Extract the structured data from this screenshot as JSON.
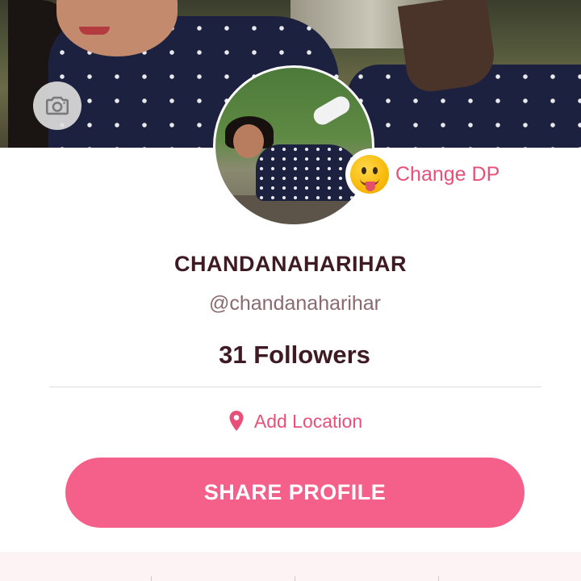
{
  "profile": {
    "display_name": "CHANDANAHARIHAR",
    "handle": "@chandanaharihar",
    "followers": "31 Followers",
    "change_dp_label": "Change DP",
    "add_location_label": "Add Location",
    "share_button_label": "SHARE PROFILE"
  },
  "icons": {
    "camera": "camera-icon",
    "location": "location-pin-icon",
    "emoji": "tongue-out-emoji-icon"
  },
  "colors": {
    "accent": "#f5608a",
    "accent_text": "#e8507a",
    "name_text": "#3e1a24",
    "handle_text": "#8a6a70"
  }
}
